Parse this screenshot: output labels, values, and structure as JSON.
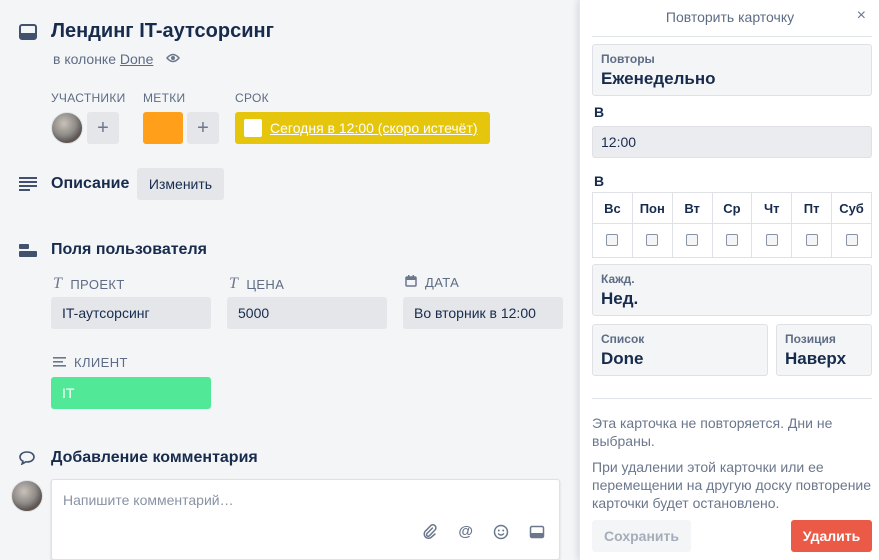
{
  "card": {
    "title": "Лендинг IT-аутсорсинг",
    "in_list_prefix": "в колонке",
    "list_name": "Done",
    "members_label": "УЧАСТНИКИ",
    "labels_label": "МЕТКИ",
    "due_label": "СРОК",
    "due_text": "Сегодня в 12:00 (скоро истечёт)",
    "label_color": "#ff9f1a",
    "due_color": "#e6c60d",
    "description_heading": "Описание",
    "edit_button": "Изменить",
    "custom_fields_heading": "Поля пользователя",
    "fields": {
      "project": {
        "label": "ПРОЕКТ",
        "value": "IT-аутсорсинг"
      },
      "price": {
        "label": "ЦЕНА",
        "value": "5000"
      },
      "date": {
        "label": "ДАТА",
        "value": "Во вторник в 12:00"
      },
      "client": {
        "label": "КЛИЕНТ",
        "value": "IT",
        "color": "#51e898"
      }
    },
    "comment_heading": "Добавление комментария",
    "comment_placeholder": "Напишите комментарий…"
  },
  "popover": {
    "title": "Повторить карточку",
    "close": "×",
    "repeats_label": "Повторы",
    "repeats_value": "Еженедельно",
    "time_label": "В",
    "time_value": "12:00",
    "days_label": "В",
    "days": [
      "Вс",
      "Пон",
      "Вт",
      "Ср",
      "Чт",
      "Пт",
      "Суб"
    ],
    "each_label": "Кажд.",
    "each_value": "Нед.",
    "list_label": "Список",
    "list_value": "Done",
    "position_label": "Позиция",
    "position_value": "Наверх",
    "note_not_repeating": "Эта карточка не повторяется. Дни не выбраны.",
    "note_delete": "При удалении этой карточки или ее перемещении на другую доску повторение карточки будет остановлено.",
    "save_button": "Сохранить",
    "delete_button": "Удалить",
    "delete_color": "#eb5a46"
  }
}
